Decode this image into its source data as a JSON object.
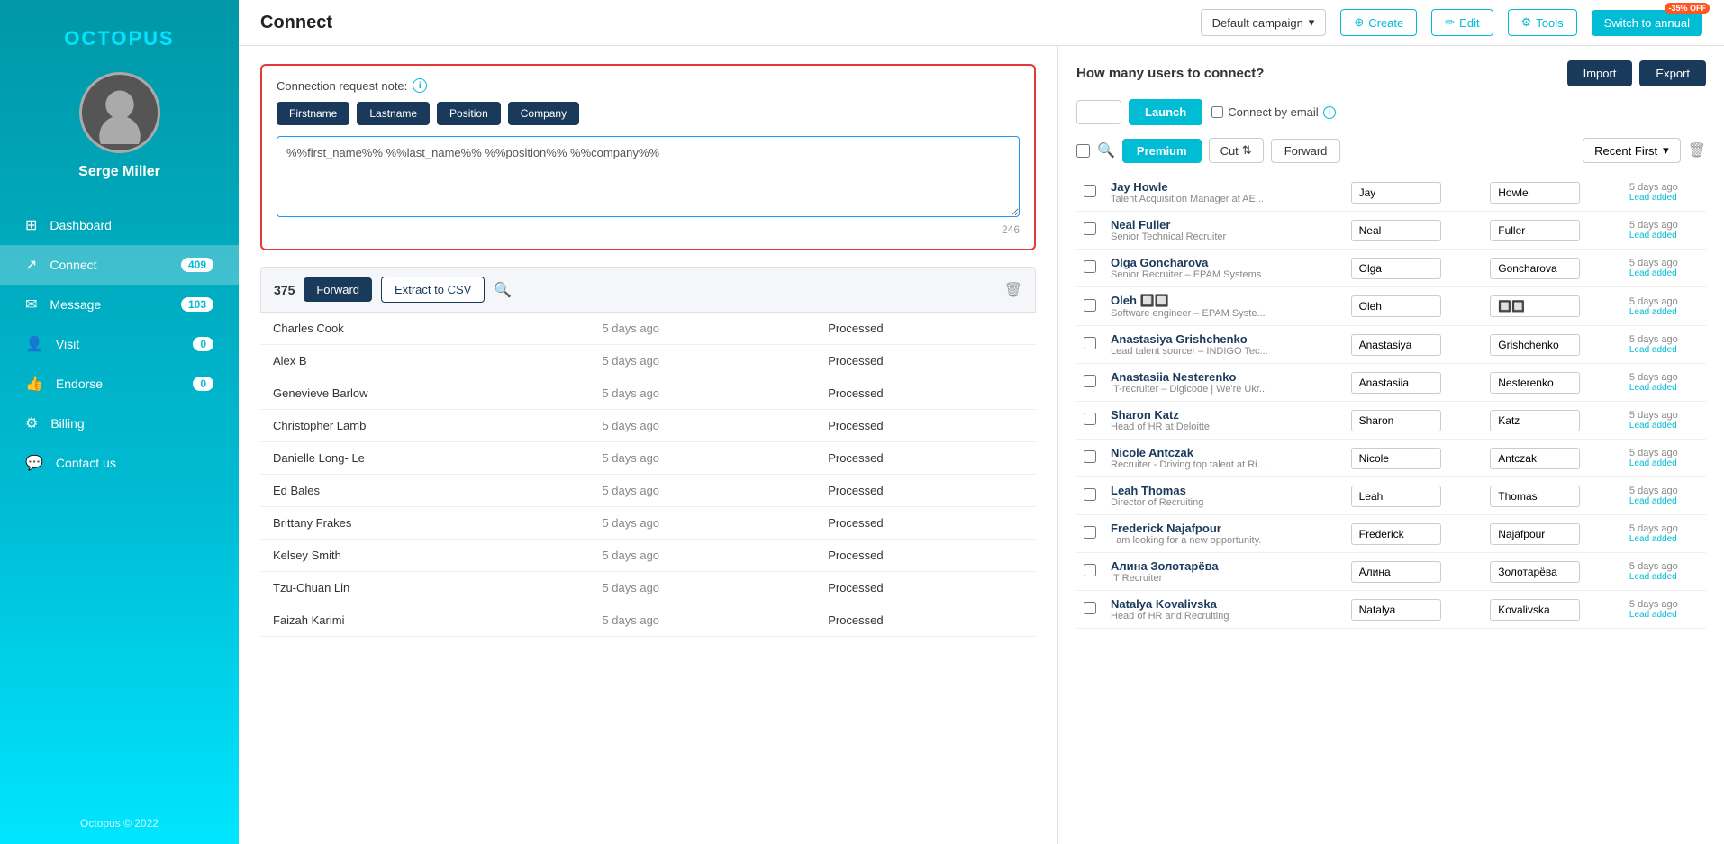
{
  "app": {
    "name": "OCTOPUS",
    "copyright": "Octopus © 2022"
  },
  "sidebar": {
    "username": "Serge Miller",
    "items": [
      {
        "id": "dashboard",
        "label": "Dashboard",
        "badge": null,
        "icon": "⊞"
      },
      {
        "id": "connect",
        "label": "Connect",
        "badge": "409",
        "icon": "↗"
      },
      {
        "id": "message",
        "label": "Message",
        "badge": "103",
        "icon": "✉"
      },
      {
        "id": "visit",
        "label": "Visit",
        "badge": "0",
        "icon": "👤"
      },
      {
        "id": "endorse",
        "label": "Endorse",
        "badge": "0",
        "icon": "👍"
      },
      {
        "id": "billing",
        "label": "Billing",
        "badge": null,
        "icon": "⚙"
      },
      {
        "id": "contact-us",
        "label": "Contact us",
        "badge": null,
        "icon": "💬"
      }
    ]
  },
  "header": {
    "title": "Connect",
    "campaign": "Default campaign",
    "create_label": "Create",
    "edit_label": "Edit",
    "tools_label": "Tools",
    "switch_label": "Switch to annual",
    "discount_badge": "-35% OFF"
  },
  "connection_note": {
    "label": "Connection request note:",
    "tags": [
      "Firstname",
      "Lastname",
      "Position",
      "Company"
    ],
    "textarea_value": "%%first_name%% %%last_name%% %%position%% %%company%%",
    "char_count": "246"
  },
  "leads_section": {
    "count": "375",
    "forward_label": "Forward",
    "extract_csv_label": "Extract to CSV",
    "rows": [
      {
        "name": "Charles Cook",
        "time": "5 days ago",
        "status": "Processed"
      },
      {
        "name": "Alex B",
        "time": "5 days ago",
        "status": "Processed"
      },
      {
        "name": "Genevieve Barlow",
        "time": "5 days ago",
        "status": "Processed"
      },
      {
        "name": "Christopher Lamb",
        "time": "5 days ago",
        "status": "Processed"
      },
      {
        "name": "Danielle Long- Le",
        "time": "5 days ago",
        "status": "Processed"
      },
      {
        "name": "Ed Bales",
        "time": "5 days ago",
        "status": "Processed"
      },
      {
        "name": "Brittany Frakes",
        "time": "5 days ago",
        "status": "Processed"
      },
      {
        "name": "Kelsey Smith",
        "time": "5 days ago",
        "status": "Processed"
      },
      {
        "name": "Tzu-Chuan Lin",
        "time": "5 days ago",
        "status": "Processed"
      },
      {
        "name": "Faizah Karimi",
        "time": "5 days ago",
        "status": "Processed"
      }
    ]
  },
  "right_panel": {
    "question": "How many users to connect?",
    "launch_label": "Launch",
    "connect_email_label": "Connect by email",
    "import_label": "Import",
    "export_label": "Export",
    "premium_label": "Premium",
    "cut_label": "Cut",
    "forward_label": "Forward",
    "recent_first_label": "Recent First",
    "contacts": [
      {
        "name": "Jay Howle",
        "subtitle": "Talent Acquisition Manager at AE...",
        "firstname": "Jay",
        "lastname": "Howle",
        "time": "5 days ago",
        "badge": "Lead added"
      },
      {
        "name": "Neal Fuller",
        "subtitle": "Senior Technical Recruiter",
        "firstname": "Neal",
        "lastname": "Fuller",
        "time": "5 days ago",
        "badge": "Lead added"
      },
      {
        "name": "Olga Goncharova",
        "subtitle": "Senior Recruiter – EPAM Systems",
        "firstname": "Olga",
        "lastname": "Goncharova",
        "time": "5 days ago",
        "badge": "Lead added"
      },
      {
        "name": "Oleh 🔲🔲",
        "subtitle": "Software engineer – EPAM Syste...",
        "firstname": "Oleh",
        "lastname": "🔲🔲",
        "time": "5 days ago",
        "badge": "Lead added"
      },
      {
        "name": "Anastasiya Grishchenko",
        "subtitle": "Lead talent sourcer – INDIGO Tec...",
        "firstname": "Anastasiya",
        "lastname": "Grishchenko",
        "time": "5 days ago",
        "badge": "Lead added"
      },
      {
        "name": "Anastasiia Nesterenko",
        "subtitle": "IT-recruiter – Digicode | We're Ukr...",
        "firstname": "Anastasiia",
        "lastname": "Nesterenko",
        "time": "5 days ago",
        "badge": "Lead added"
      },
      {
        "name": "Sharon Katz",
        "subtitle": "Head of HR at Deloitte",
        "firstname": "Sharon",
        "lastname": "Katz",
        "time": "5 days ago",
        "badge": "Lead added"
      },
      {
        "name": "Nicole Antczak",
        "subtitle": "Recruiter - Driving top talent at Ri...",
        "firstname": "Nicole",
        "lastname": "Antczak",
        "time": "5 days ago",
        "badge": "Lead added"
      },
      {
        "name": "Leah Thomas",
        "subtitle": "Director of Recruiting",
        "firstname": "Leah",
        "lastname": "Thomas",
        "time": "5 days ago",
        "badge": "Lead added"
      },
      {
        "name": "Frederick Najafpour",
        "subtitle": "I am looking for a new opportunity.",
        "firstname": "Frederick",
        "lastname": "Najafpour",
        "time": "5 days ago",
        "badge": "Lead added"
      },
      {
        "name": "Алина Золотарёва",
        "subtitle": "IT Recruiter",
        "firstname": "Алина",
        "lastname": "Золотарёва",
        "time": "5 days ago",
        "badge": "Lead added"
      },
      {
        "name": "Natalya Kovalivska",
        "subtitle": "Head of HR and Recruiting",
        "firstname": "Natalya",
        "lastname": "Kovalivska",
        "time": "5 days ago",
        "badge": "Lead added"
      }
    ]
  }
}
